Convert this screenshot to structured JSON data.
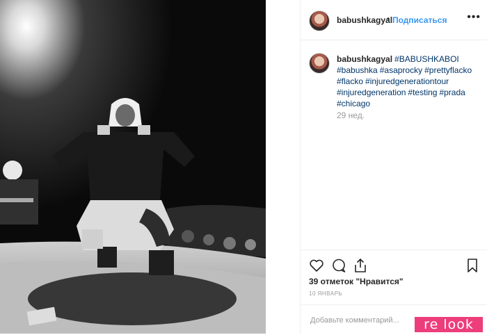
{
  "post": {
    "username": "babushkagyal",
    "separator": "•",
    "follow_label": "Подписаться",
    "more_label": "•••"
  },
  "caption": {
    "username": "babushkagyal",
    "hashtags": [
      "#BABUSHKABOI",
      "#babushka",
      "#asaprocky",
      "#prettyflacko",
      "#flacko",
      "#injuredgenerationtour",
      "#injuredgeneration",
      "#testing",
      "#prada",
      "#chicago"
    ],
    "age": "29 нед."
  },
  "actions": {
    "likes_text": "39 отметок \"Нравится\"",
    "date": "10 ЯНВАРЬ",
    "like_icon": "heart-icon",
    "comment_icon": "comment-icon",
    "share_icon": "share-icon",
    "save_icon": "bookmark-icon"
  },
  "comment": {
    "placeholder": "Добавьте комментарий..."
  },
  "watermark": {
    "text": "re look",
    "color": "#ed3d7a"
  },
  "colors": {
    "link": "#3897f0",
    "hashtag": "#003569",
    "muted": "#999999",
    "border": "#efefef"
  }
}
